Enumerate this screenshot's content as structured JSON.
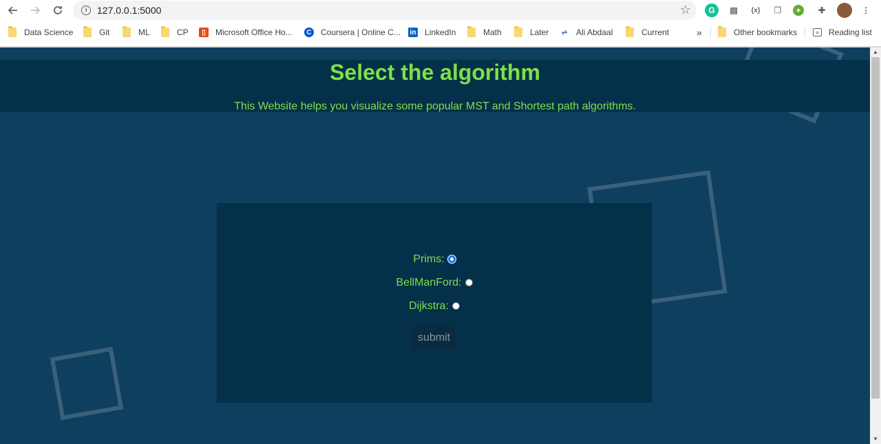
{
  "browser": {
    "url": "127.0.0.1:5000",
    "bookmarks": [
      {
        "label": "Data Science",
        "icon": "folder"
      },
      {
        "label": "Git",
        "icon": "folder"
      },
      {
        "label": "ML",
        "icon": "folder"
      },
      {
        "label": "CP",
        "icon": "folder"
      },
      {
        "label": "Microsoft Office Ho...",
        "icon": "office-icon"
      },
      {
        "label": "Coursera | Online C...",
        "icon": "coursera-icon"
      },
      {
        "label": "LinkedIn",
        "icon": "linkedin-icon"
      },
      {
        "label": "Math",
        "icon": "folder"
      },
      {
        "label": "Later",
        "icon": "folder"
      },
      {
        "label": "Ali Abdaal",
        "icon": "ali-abdaal-icon"
      },
      {
        "label": "Current",
        "icon": "folder"
      }
    ],
    "overflow_label": "»",
    "other_bookmarks": "Other bookmarks",
    "reading_list": "Reading list"
  },
  "page": {
    "title": "Select the algorithm",
    "subtitle": "This Website helps you visualize some popular MST and Shortest path algorithms.",
    "options": [
      {
        "label": "Prims:",
        "checked": true
      },
      {
        "label": "BellManFord:",
        "checked": false
      },
      {
        "label": "Dijkstra:",
        "checked": false
      }
    ],
    "submit_label": "submit"
  },
  "colors": {
    "background": "#0e3f5e",
    "panel": "#05304a",
    "accent_text": "#7ee048"
  }
}
